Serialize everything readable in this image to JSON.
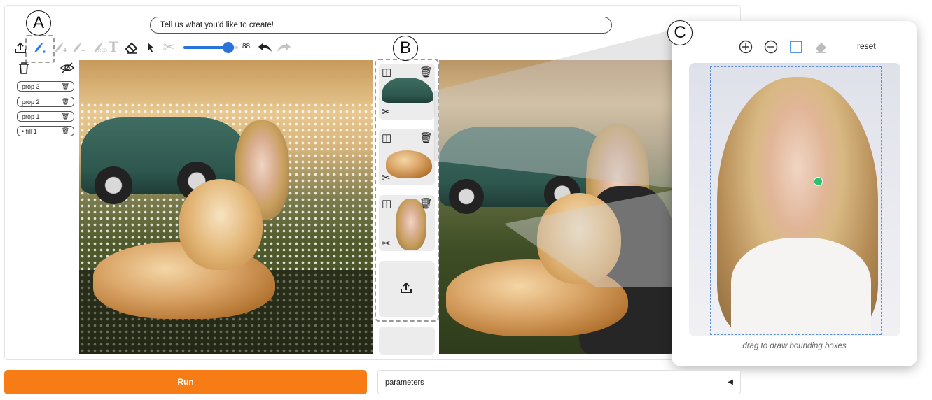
{
  "prompt": {
    "text": "Tell us what you'd like to create!"
  },
  "callouts": {
    "a": "A",
    "b": "B",
    "c": "C"
  },
  "toolbar": {
    "brush_size": "88",
    "tools": [
      "upload-icon",
      "brush-icon",
      "add-brush-icon",
      "subtract-brush-icon",
      "rgb-brush-icon",
      "text-icon",
      "eraser-icon",
      "pointer-icon",
      "scissors-icon",
      "undo-icon",
      "redo-icon"
    ],
    "rgb_label": "RGB",
    "active_color": "#2a7de1",
    "slider_color": "#2a73d9"
  },
  "layers": {
    "items": [
      {
        "label": "prop 3"
      },
      {
        "label": "prop 2"
      },
      {
        "label": "prop 1"
      },
      {
        "label": "• fill 1"
      }
    ]
  },
  "gallery": {
    "upload_icon": "upload-icon"
  },
  "zoom_panel": {
    "reset_label": "reset",
    "caption": "drag to draw bounding boxes",
    "bbox_color": "#5b8fde",
    "point_color": "#2fbf71"
  },
  "actions": {
    "run_label": "Run",
    "run_color": "#f77c16",
    "parameters_label": "parameters",
    "parameters_caret": "◀"
  }
}
